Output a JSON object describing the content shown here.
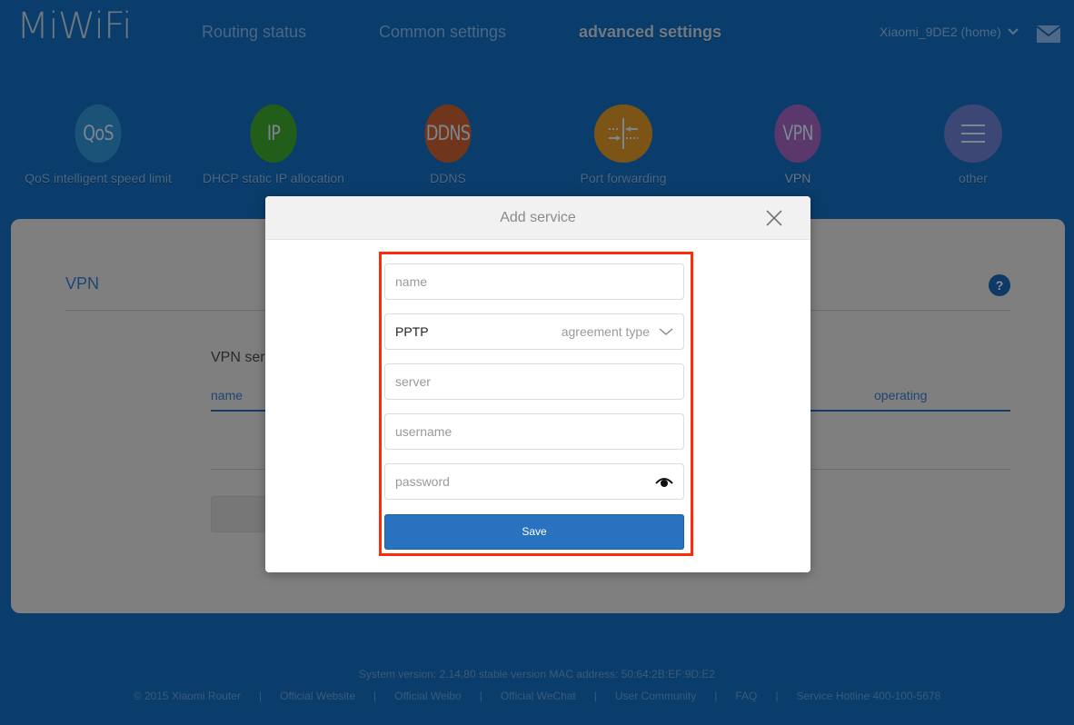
{
  "header": {
    "logo": "MiWiFi",
    "nav": [
      {
        "label": "Routing status",
        "active": false
      },
      {
        "label": "Common settings",
        "active": false
      },
      {
        "label": "advanced settings",
        "active": true
      }
    ],
    "router_name": "Xiaomi_9DE2 (home)"
  },
  "features": [
    {
      "icon_text": "QoS",
      "label": "QoS intelligent speed limit",
      "color": "#1a5377"
    },
    {
      "icon_text": "IP",
      "label": "DHCP static IP allocation",
      "color": "#225e1a"
    },
    {
      "icon_text": "DDNS",
      "label": "DDNS",
      "color": "#70361b"
    },
    {
      "icon_text": "",
      "icon": "port-forward-icon",
      "label": "Port forwarding",
      "color": "#7c5516"
    },
    {
      "icon_text": "VPN",
      "label": "VPN",
      "color": "#5a386b",
      "active": true
    },
    {
      "icon_text": "",
      "icon": "menu-icon",
      "label": "other",
      "color": "#3d4776"
    }
  ],
  "card": {
    "title": "VPN",
    "section_title": "VPN server list",
    "columns": [
      "name",
      "operating"
    ]
  },
  "modal": {
    "title": "Add service",
    "fields": {
      "name_placeholder": "name",
      "protocol_value": "PPTP",
      "protocol_hint": "agreement type",
      "server_placeholder": "server",
      "username_placeholder": "username",
      "password_placeholder": "password"
    },
    "save_label": "Save",
    "highlight_color": "#ff2a0a"
  },
  "footer": {
    "version": "System version: 2.14.80 stable version MAC address: 50:64:2B:EF:9D:E2",
    "links": [
      "© 2015 Xiaomi Router",
      "Official Website",
      "Official Weibo",
      "Official WeChat",
      "User Community",
      "FAQ",
      "Service Hotline 400-100-5678"
    ]
  }
}
